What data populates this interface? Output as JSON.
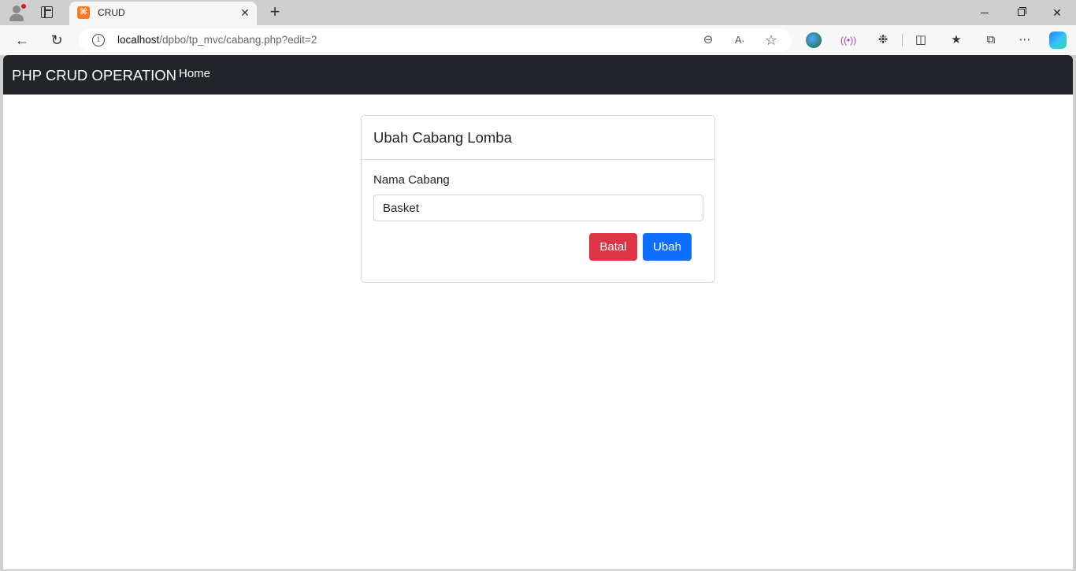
{
  "browser": {
    "tab_title": "CRUD",
    "tab_favicon_glyph": "⌘",
    "url_host": "localhost",
    "url_path": "/dpbo/tp_mvc/cabang.php?edit=2",
    "icons": {
      "back": "←",
      "reload": "↻",
      "info": "i",
      "zoom": "⊖",
      "read_aloud": "A⸳",
      "favorite": "☆",
      "extensions": "❉",
      "split": "◫",
      "favorites": "★",
      "collections": "⧉",
      "more": "⋯",
      "new_tab": "+",
      "close_tab": "✕",
      "win_close": "✕",
      "radio": "((•))"
    }
  },
  "navbar": {
    "brand": "PHP CRUD OPERATION",
    "home": "Home"
  },
  "form": {
    "title": "Ubah Cabang Lomba",
    "label": "Nama Cabang",
    "value": "Basket",
    "cancel": "Batal",
    "submit": "Ubah"
  },
  "colors": {
    "navbar_bg": "#212529",
    "cancel_bg": "#dc3545",
    "submit_bg": "#0d6efd",
    "favicon": "#fb7a24"
  }
}
